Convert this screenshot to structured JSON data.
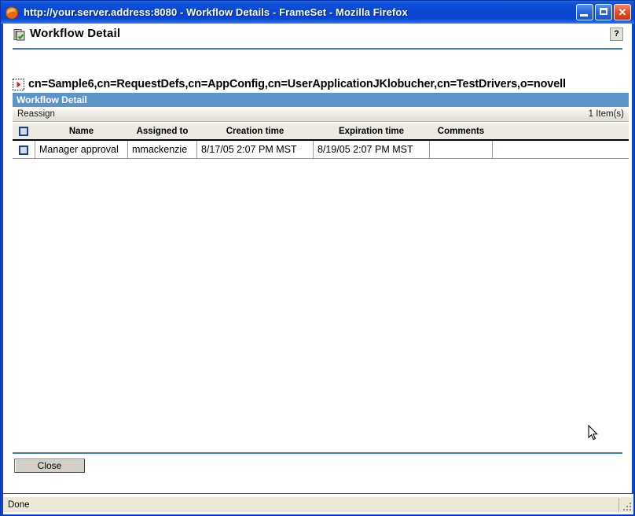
{
  "window": {
    "title": "http://your.server.address:8080 - Workflow Details - FrameSet - Mozilla Firefox",
    "app_icon": "firefox-icon",
    "minimize_label": "Minimize",
    "maximize_label": "Maximize",
    "close_label": "Close",
    "close_glyph": "✕",
    "frame_color": "#0a46d2"
  },
  "page": {
    "icon": "workflow-document-icon",
    "title": "Workflow Detail",
    "help_label": "?",
    "rule_color": "#3f7fbf"
  },
  "dn": {
    "icon": "tree-expand-icon",
    "text": "cn=Sample6,cn=RequestDefs,cn=AppConfig,cn=UserApplicationJKlobucher,cn=TestDrivers,o=novell"
  },
  "section": {
    "title": "Workflow Detail",
    "bar_color": "#5a94c8"
  },
  "toolbar": {
    "reassign_label": "Reassign",
    "item_count": "1 Item(s)"
  },
  "table": {
    "select_all_label": "",
    "columns": [
      "Name",
      "Assigned to",
      "Creation time",
      "Expiration time",
      "Comments"
    ],
    "rows": [
      {
        "selected": false,
        "name": "Manager approval",
        "assigned_to": "mmackenzie",
        "creation_time": "8/17/05 2:07 PM MST",
        "expiration_time": "8/19/05 2:07 PM MST",
        "comments": ""
      }
    ]
  },
  "footer": {
    "close_label": "Close"
  },
  "status": {
    "text": "Done"
  }
}
